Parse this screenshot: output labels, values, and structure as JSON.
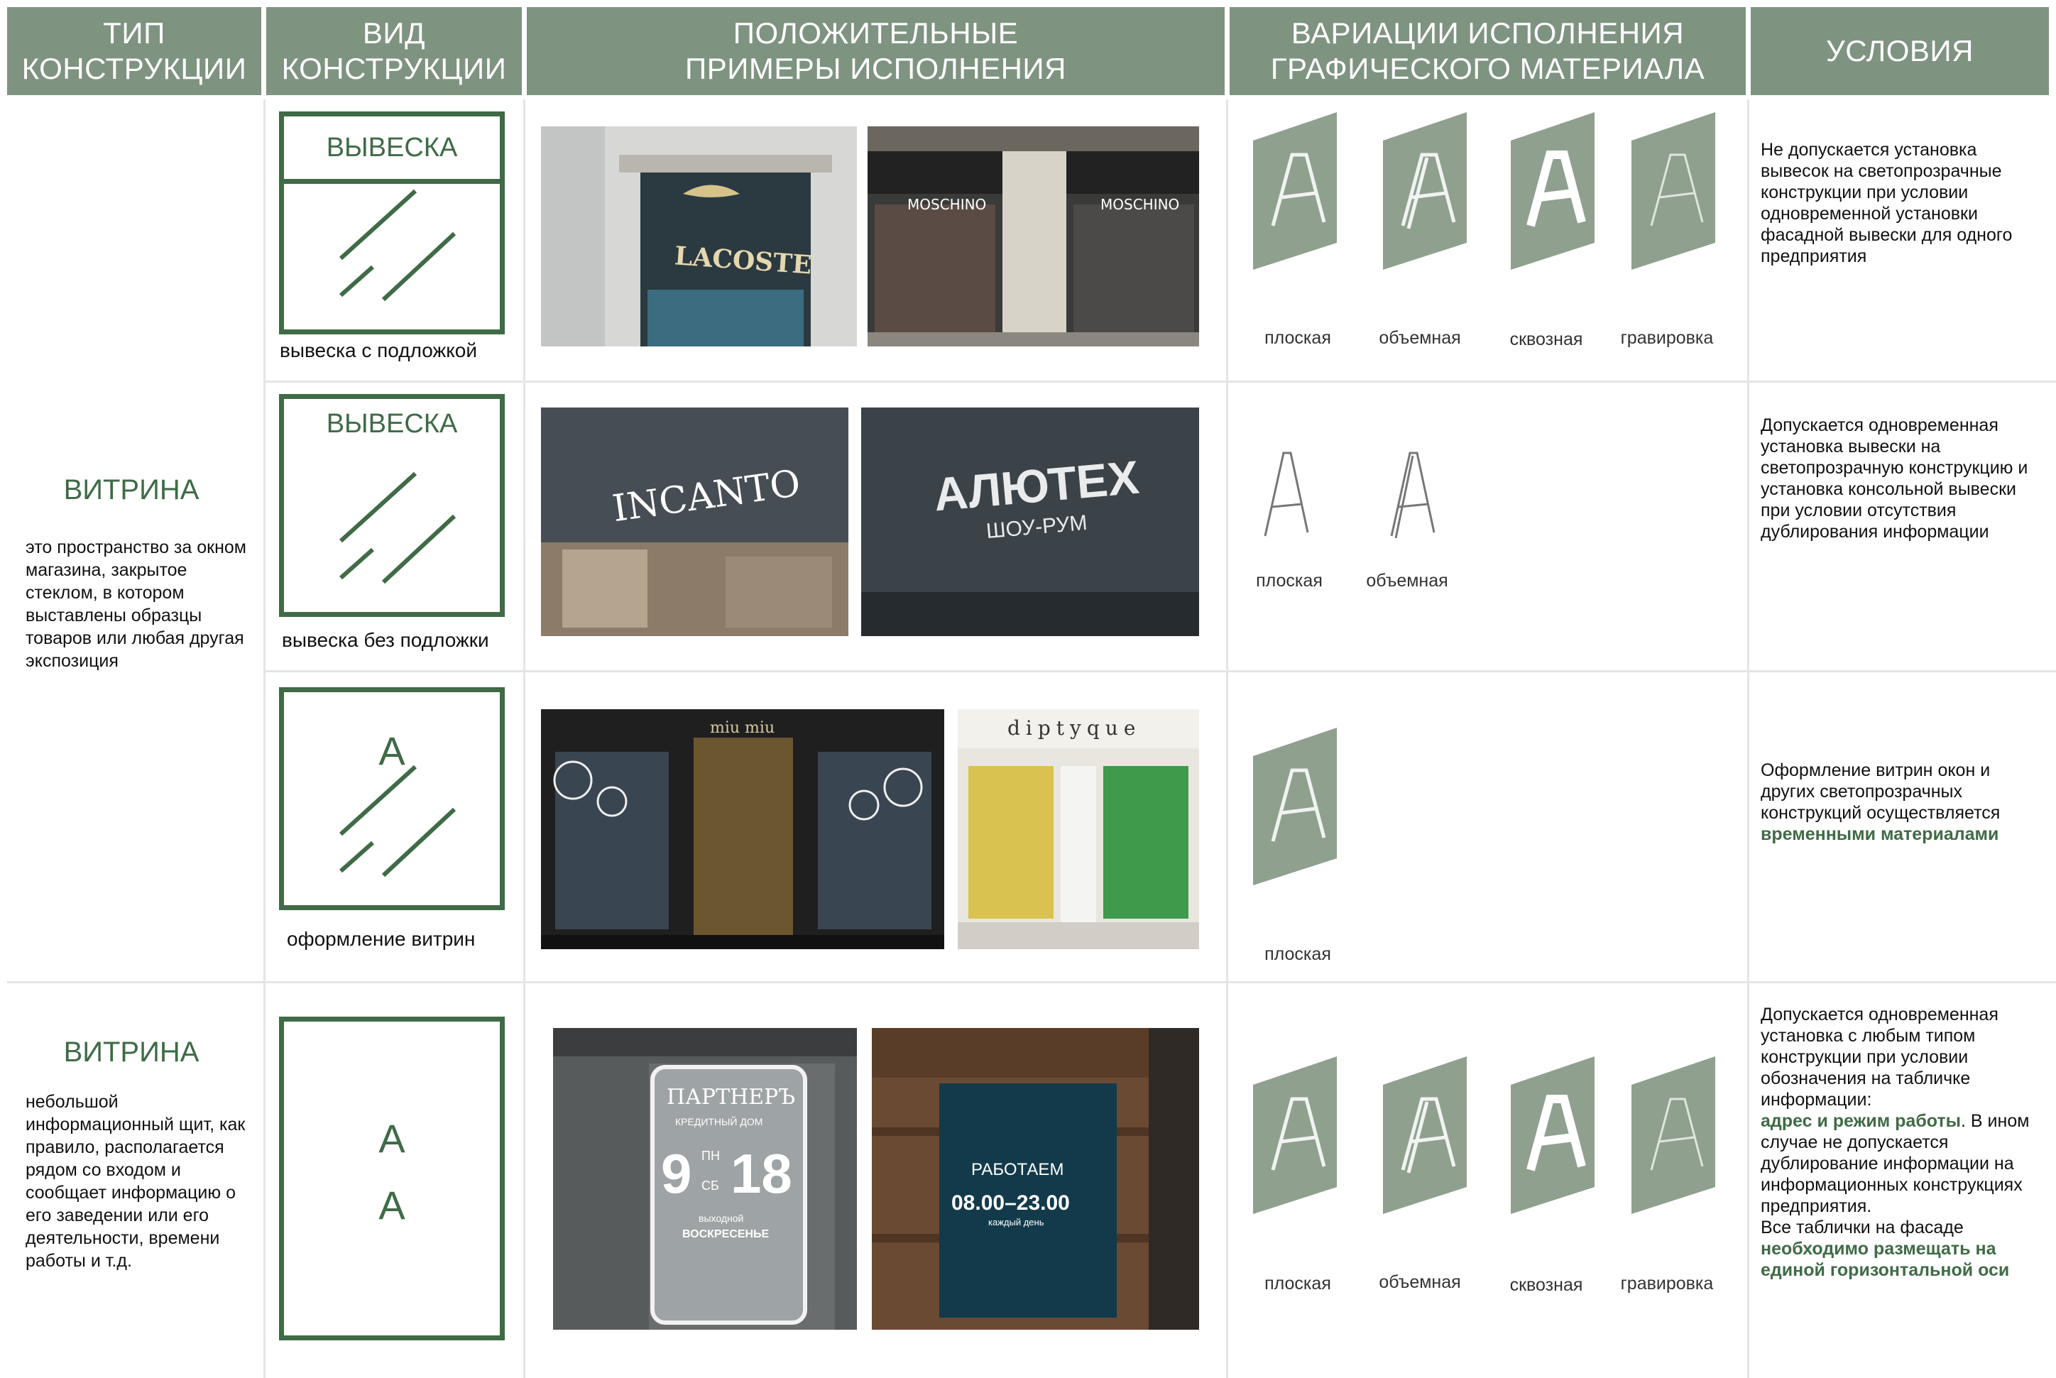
{
  "header": {
    "col1": "ТИП\nКОНСТРУКЦИИ",
    "col2": "ВИД\nКОНСТРУКЦИИ",
    "col3": "ПОЛОЖИТЕЛЬНЫЕ\nПРИМЕРЫ ИСПОЛНЕНИЯ",
    "col4": "ВАРИАЦИИ ИСПОЛНЕНИЯ\nГРАФИЧЕСКОГО МАТЕРИАЛА",
    "col5": "УСЛОВИЯ"
  },
  "colors": {
    "accent": "#3f6b46",
    "header_bg": "#7e9380",
    "panel": "#8fa08f"
  },
  "type1": {
    "name": "ВИТРИНА",
    "description": "это пространство за окном магазина, закрытое стеклом, в котором выставлены образцы товаров или любая другая экспозиция"
  },
  "type2": {
    "name": "ВИТРИНА",
    "description": "небольшой информационный щит, как правило, располагается рядом со входом и сообщает информацию о его заведении или его деятельности, времени работы и т.д."
  },
  "rows": [
    {
      "box_title": "ВЫВЕСКА",
      "caption": "вывеска с подложкой",
      "photos": [
        {
          "sign": "LACOSTE",
          "icon": "crocodile-logo-icon"
        },
        {
          "sign_left": "MOSCHINO",
          "sign_right": "MOSCHINO"
        }
      ],
      "variants": [
        "плоская",
        "объемная",
        "сквозная",
        "гравировка"
      ],
      "condition": "Не допускается установка вывесок на светопрозрачные конструкции при условии одновременной установки фасадной вывески для одного предприятия"
    },
    {
      "box_title": "ВЫВЕСКА",
      "caption": "вывеска без подложки",
      "photos": [
        {
          "sign": "INCANTO"
        },
        {
          "sign": "АЛЮТЕХ",
          "sub": "ШОУ-РУМ"
        }
      ],
      "variants": [
        "плоская",
        "объемная"
      ],
      "condition": "Допускается одновременная установка вывески на светопрозрачную конструкцию и установка консольной вывески при условии отсутствия дублирования информации"
    },
    {
      "box_letter": "А",
      "caption": "оформление витрин",
      "photos": [
        {
          "sign": "miu miu"
        },
        {
          "sign": "diptyque"
        }
      ],
      "variants": [
        "плоская"
      ],
      "condition_text": "Оформление витрин окон и других светопрозрачных конструкций осуществляется ",
      "condition_highlight": "временными материалами"
    },
    {
      "box_letters": [
        "А",
        "А"
      ],
      "photos": [
        {
          "brand": "ПАРТНЕРЪ",
          "subtitle": "КРЕДИТНЫЙ ДОМ",
          "hours_open": "9",
          "hours_close": "18",
          "day1": "ПН",
          "day2": "СБ",
          "dayoff_label": "выходной",
          "dayoff": "ВОСКРЕСЕНЬЕ"
        },
        {
          "title": "РАБОТАЕМ",
          "hours": "08.00–23.00",
          "sub": "каждый день"
        }
      ],
      "variants": [
        "плоская",
        "объемная",
        "сквозная",
        "гравировка"
      ],
      "condition_parts": {
        "p1": "Допускается одновременная установка с любым типом конструкции при условии обозначения на табличке информации:",
        "h1": "адрес и режим работы",
        "p2": ". В ином случае не допускается дублирование информации на информационных конструкциях предприятия.",
        "p3": "Все таблички на фасаде",
        "h2": "необходимо размещать на единой горизонтальной оси"
      }
    }
  ]
}
